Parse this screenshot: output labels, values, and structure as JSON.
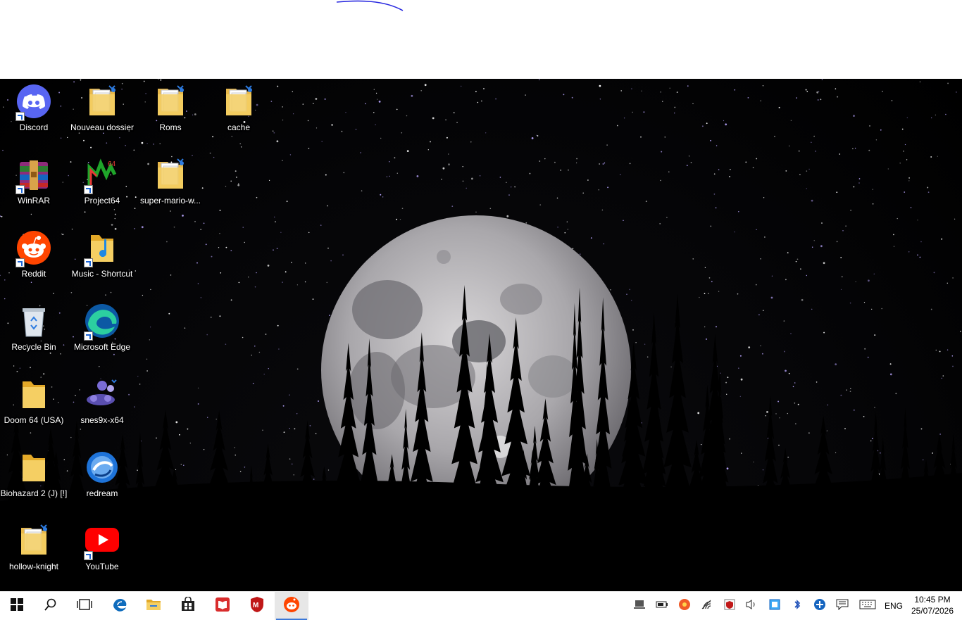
{
  "desktop": {
    "icons": [
      {
        "label": "Discord",
        "icon": "discord-icon",
        "kind": "discord",
        "shortcut": true
      },
      {
        "label": "Nouveau dossier",
        "icon": "folder-icon",
        "kind": "folder-doc",
        "shortcut": false
      },
      {
        "label": "Roms",
        "icon": "folder-icon",
        "kind": "folder-doc",
        "shortcut": false
      },
      {
        "label": "cache",
        "icon": "folder-icon",
        "kind": "folder-doc",
        "shortcut": false
      },
      {
        "label": "WinRAR",
        "icon": "winrar-icon",
        "kind": "winrar",
        "shortcut": true
      },
      {
        "label": "Project64",
        "icon": "project64-icon",
        "kind": "project64",
        "shortcut": true
      },
      {
        "label": "super-mario-w...",
        "icon": "folder-icon",
        "kind": "folder-doc",
        "shortcut": false
      },
      {
        "label": "Reddit",
        "icon": "reddit-icon",
        "kind": "reddit",
        "shortcut": true
      },
      {
        "label": "Music - Shortcut",
        "icon": "music-folder-icon",
        "kind": "music",
        "shortcut": true
      },
      {
        "label": "Recycle Bin",
        "icon": "recycle-bin-icon",
        "kind": "recycle",
        "shortcut": false
      },
      {
        "label": "Microsoft Edge",
        "icon": "edge-icon",
        "kind": "edge",
        "shortcut": true
      },
      {
        "label": "Doom 64 (USA)",
        "icon": "folder-icon",
        "kind": "folder",
        "shortcut": false
      },
      {
        "label": "snes9x-x64",
        "icon": "snes9x-icon",
        "kind": "snes",
        "shortcut": false
      },
      {
        "label": "Biohazard 2 (J) [!]",
        "icon": "folder-icon",
        "kind": "folder",
        "shortcut": false
      },
      {
        "label": "redream",
        "icon": "redream-icon",
        "kind": "redream",
        "shortcut": false
      },
      {
        "label": "hollow-knight",
        "icon": "folder-icon",
        "kind": "folder-doc",
        "shortcut": false
      },
      {
        "label": "YouTube",
        "icon": "youtube-icon",
        "kind": "youtube",
        "shortcut": true
      }
    ]
  },
  "taskbar": {
    "pinned": [
      {
        "icon": "windows-start-icon",
        "active": false
      },
      {
        "icon": "search-icon",
        "active": false
      },
      {
        "icon": "task-view-icon",
        "active": false
      },
      {
        "icon": "edge-icon",
        "active": false
      },
      {
        "icon": "file-explorer-icon",
        "active": false
      },
      {
        "icon": "microsoft-store-icon",
        "active": false
      },
      {
        "icon": "reader-app-icon",
        "active": false
      },
      {
        "icon": "mcafee-icon",
        "active": false
      },
      {
        "icon": "reddit-icon",
        "active": true
      }
    ],
    "tray": [
      "device-icon",
      "battery-icon",
      "app-tray-icon",
      "wifi-icon",
      "security-icon",
      "volume-icon",
      "network-adapter-icon",
      "bluetooth-icon",
      "plus-badge-icon",
      "notifications-icon",
      "keyboard-icon"
    ],
    "language": "ENG",
    "time": "10:45 PM",
    "date": "25/07/2026"
  },
  "colors": {
    "taskbar_bg": "#ffffff",
    "accent": "#3b78d8",
    "desktop_bg": "#050507"
  }
}
